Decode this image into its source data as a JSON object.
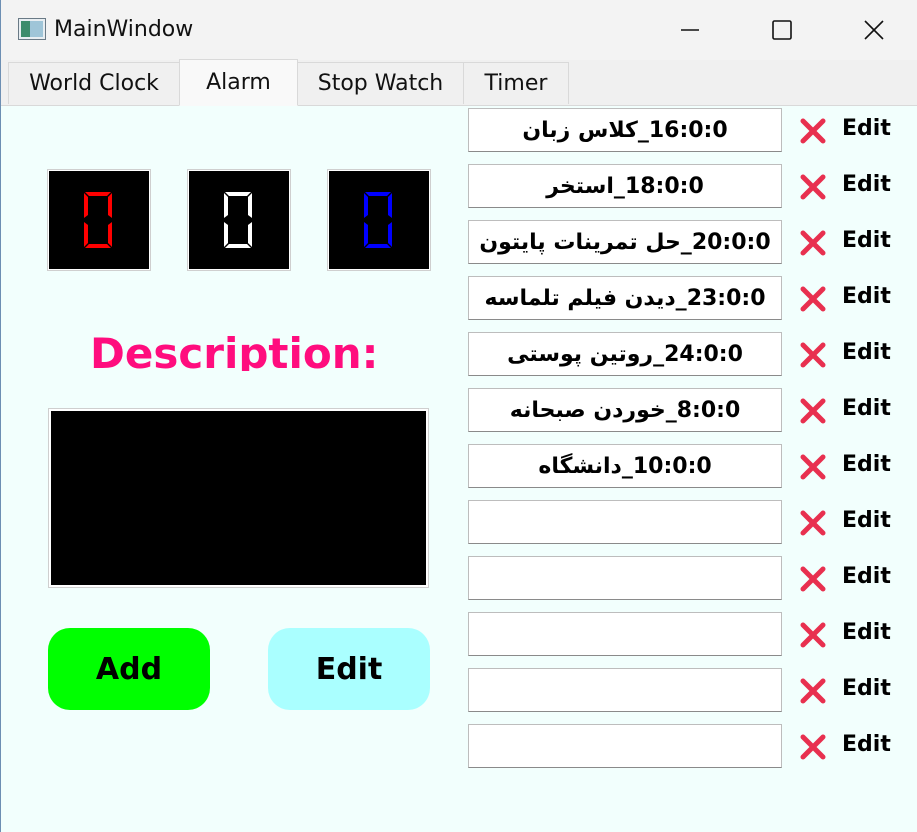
{
  "window": {
    "title": "MainWindow"
  },
  "tabs": [
    {
      "label": "World Clock"
    },
    {
      "label": "Alarm"
    },
    {
      "label": "Stop Watch"
    },
    {
      "label": "Timer"
    }
  ],
  "alarm_panel": {
    "hours_digit": "0",
    "minutes_digit": "0",
    "seconds_digit": "0",
    "digit_colors": [
      "#ff0000",
      "#ffffff",
      "#0000ff"
    ],
    "description_label": "Description:",
    "add_label": "Add",
    "edit_label": "Edit"
  },
  "alarms": [
    {
      "text": "16:0:0_کلاس زبان",
      "edit_label": "Edit"
    },
    {
      "text": "18:0:0_استخر",
      "edit_label": "Edit"
    },
    {
      "text": "20:0:0_حل تمرینات پایتون",
      "edit_label": "Edit"
    },
    {
      "text": "23:0:0_دیدن فیلم تلماسه",
      "edit_label": "Edit"
    },
    {
      "text": "24:0:0_روتین پوستی",
      "edit_label": "Edit"
    },
    {
      "text": "8:0:0_خوردن صبحانه",
      "edit_label": "Edit"
    },
    {
      "text": "10:0:0_دانشگاه",
      "edit_label": "Edit"
    },
    {
      "text": "",
      "edit_label": "Edit"
    },
    {
      "text": "",
      "edit_label": "Edit"
    },
    {
      "text": "",
      "edit_label": "Edit"
    },
    {
      "text": "",
      "edit_label": "Edit"
    },
    {
      "text": "",
      "edit_label": "Edit"
    }
  ],
  "icons": {
    "delete": "x-icon",
    "minimize": "minimize-icon",
    "maximize": "maximize-icon",
    "close": "close-icon",
    "app": "app-icon"
  },
  "colors": {
    "delete_icon": "#e8304f",
    "add_button": "#00ff00",
    "edit_button": "#aaffff",
    "description": "#ff0d7e"
  }
}
